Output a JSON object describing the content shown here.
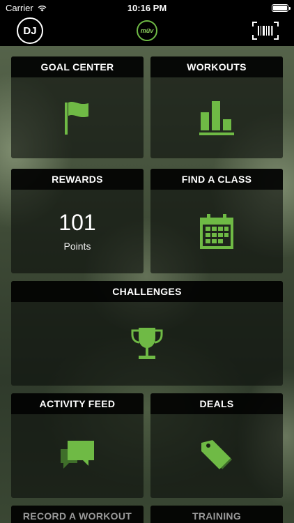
{
  "status": {
    "carrier": "Carrier",
    "time": "10:16 PM"
  },
  "nav": {
    "avatar_initials": "DJ",
    "logo_text": "müv"
  },
  "tiles": {
    "goal_center": "GOAL CENTER",
    "workouts": "WORKOUTS",
    "rewards": "REWARDS",
    "rewards_points": "101",
    "rewards_points_label": "Points",
    "find_a_class": "FIND A CLASS",
    "challenges": "CHALLENGES",
    "activity_feed": "ACTIVITY FEED",
    "deals": "DEALS",
    "record_a_workout": "RECORD A WORKOUT",
    "training": "TRAINING"
  },
  "colors": {
    "accent": "#6fba45",
    "tile_bg": "#0c0e0b",
    "header_bg": "#000000"
  },
  "icons": {
    "goal_center": "flag-icon",
    "workouts": "bar-chart-icon",
    "find_a_class": "calendar-icon",
    "challenges": "trophy-icon",
    "activity_feed": "chat-bubbles-icon",
    "deals": "tags-icon"
  }
}
